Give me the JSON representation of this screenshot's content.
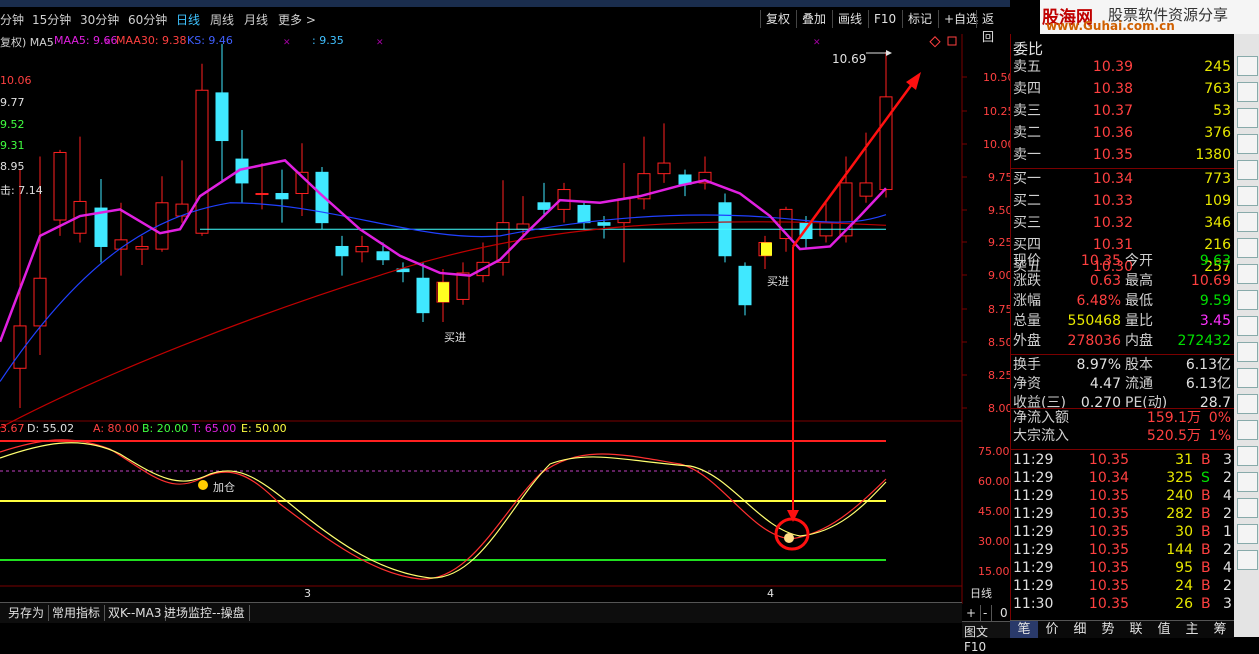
{
  "toolbar": {
    "periods": [
      "分钟",
      "15分钟",
      "30分钟",
      "60分钟",
      "日线",
      "周线",
      "月线",
      "更多 >"
    ],
    "active_period": "日线",
    "buttons": [
      "复权",
      "叠加",
      "画线",
      "F10",
      "标记",
      "+自选",
      "返回"
    ]
  },
  "logo": {
    "line1": "股海网",
    "line2": "股票软件资源分享",
    "line3": "www.Guhai.com.cn"
  },
  "main_legend": {
    "prefix": "复权) MA5",
    "maa5": "MAA5: 9.66",
    "maa30": "MAA30: 9.38",
    "ks": "KS: 9.46",
    "extra": ": 9.35"
  },
  "side_values": [
    "10.06",
    "9.77",
    "9.52",
    "9.31",
    "8.95",
    "击: 7.14"
  ],
  "price_axis": [
    "10.50",
    "10.25",
    "10.00",
    "9.75",
    "9.50",
    "9.25",
    "9.00",
    "8.75",
    "8.50",
    "8.25",
    "8.00"
  ],
  "high_label": "10.69",
  "buy_labels": [
    "买进",
    "买进"
  ],
  "kd_legend": {
    "k": "3.67",
    "d": "D: 55.02",
    "a": "A: 80.00",
    "b": "B: 20.00",
    "t": "T: 65.00",
    "e": "E: 50.00"
  },
  "kd_axis": [
    "75.00",
    "60.00",
    "45.00",
    "30.00",
    "15.00"
  ],
  "kd_label": "加仓",
  "date_marks": [
    "3",
    "4"
  ],
  "period_label": "日线",
  "zoom_buttons": [
    "+",
    "-",
    "0"
  ],
  "bottom_tabs": [
    "另存为",
    "常用指标",
    "双K--MA3",
    "进场监控--操盘"
  ],
  "panel_title": "委比",
  "sells": [
    {
      "label": "卖五",
      "price": "10.39",
      "vol": "245"
    },
    {
      "label": "卖四",
      "price": "10.38",
      "vol": "763"
    },
    {
      "label": "卖三",
      "price": "10.37",
      "vol": "53"
    },
    {
      "label": "卖二",
      "price": "10.36",
      "vol": "376"
    },
    {
      "label": "卖一",
      "price": "10.35",
      "vol": "1380"
    }
  ],
  "buys": [
    {
      "label": "买一",
      "price": "10.34",
      "vol": "773"
    },
    {
      "label": "买二",
      "price": "10.33",
      "vol": "109"
    },
    {
      "label": "买三",
      "price": "10.32",
      "vol": "346"
    },
    {
      "label": "买四",
      "price": "10.31",
      "vol": "216"
    },
    {
      "label": "买五",
      "price": "10.30",
      "vol": "257"
    }
  ],
  "quote": [
    {
      "l1": "现价",
      "v1": "10.35",
      "c1": "red",
      "l2": "今开",
      "v2": "9.63",
      "c2": "green"
    },
    {
      "l1": "涨跌",
      "v1": "0.63",
      "c1": "red",
      "l2": "最高",
      "v2": "10.69",
      "c2": "red"
    },
    {
      "l1": "涨幅",
      "v1": "6.48%",
      "c1": "red",
      "l2": "最低",
      "v2": "9.59",
      "c2": "green"
    },
    {
      "l1": "总量",
      "v1": "550468",
      "c1": "yellow",
      "l2": "量比",
      "v2": "3.45",
      "c2": "magenta"
    },
    {
      "l1": "外盘",
      "v1": "278036",
      "c1": "red",
      "l2": "内盘",
      "v2": "272432",
      "c2": "green"
    }
  ],
  "fund": [
    {
      "l1": "换手",
      "v1": "8.97%",
      "l2": "股本",
      "v2": "6.13亿"
    },
    {
      "l1": "净资",
      "v1": "4.47",
      "l2": "流通",
      "v2": "6.13亿"
    },
    {
      "l1": "收益(三)",
      "v1": "0.270",
      "l2": "PE(动)",
      "v2": "28.7"
    }
  ],
  "flows": [
    {
      "label": "净流入额",
      "value": "159.1万",
      "pct": "0%"
    },
    {
      "label": "大宗流入",
      "value": "520.5万",
      "pct": "1%"
    }
  ],
  "ticks": [
    {
      "time": "11:29",
      "price": "10.35",
      "vol": "31",
      "side": "B",
      "n": "3"
    },
    {
      "time": "11:29",
      "price": "10.34",
      "vol": "325",
      "side": "S",
      "n": "2"
    },
    {
      "time": "11:29",
      "price": "10.35",
      "vol": "240",
      "side": "B",
      "n": "4"
    },
    {
      "time": "11:29",
      "price": "10.35",
      "vol": "282",
      "side": "B",
      "n": "2"
    },
    {
      "time": "11:29",
      "price": "10.35",
      "vol": "30",
      "side": "B",
      "n": "1"
    },
    {
      "time": "11:29",
      "price": "10.35",
      "vol": "144",
      "side": "B",
      "n": "2"
    },
    {
      "time": "11:29",
      "price": "10.35",
      "vol": "95",
      "side": "B",
      "n": "4"
    },
    {
      "time": "11:29",
      "price": "10.35",
      "vol": "24",
      "side": "B",
      "n": "2"
    },
    {
      "time": "11:30",
      "price": "10.35",
      "vol": "26",
      "side": "B",
      "n": "3"
    }
  ],
  "panel_tabs": [
    "笔",
    "价",
    "细",
    "势",
    "联",
    "值",
    "主",
    "筹"
  ],
  "bottom_right": "图文F10",
  "tool_icons": [
    "grid-icon",
    "list-icon",
    "grid2-icon",
    "trend-icon",
    "cross-icon",
    "candle-icon",
    "stack-icon",
    "monitor-icon",
    "table-icon",
    "f10-icon",
    "f12-icon",
    "f10b-icon",
    "f10c-icon",
    "vol-icon",
    "rsi-icon",
    "compass-icon",
    "pencil-icon",
    "grid3-icon",
    "doc-icon",
    "clock-icon"
  ],
  "colors": {
    "up": "#ff3030",
    "down": "#40e0ff",
    "ma_magenta": "#e020e0",
    "ma_blue": "#2040ff",
    "ma_red": "#c00000",
    "arrow": "#ff2020",
    "yellow": "#ffff40"
  }
}
